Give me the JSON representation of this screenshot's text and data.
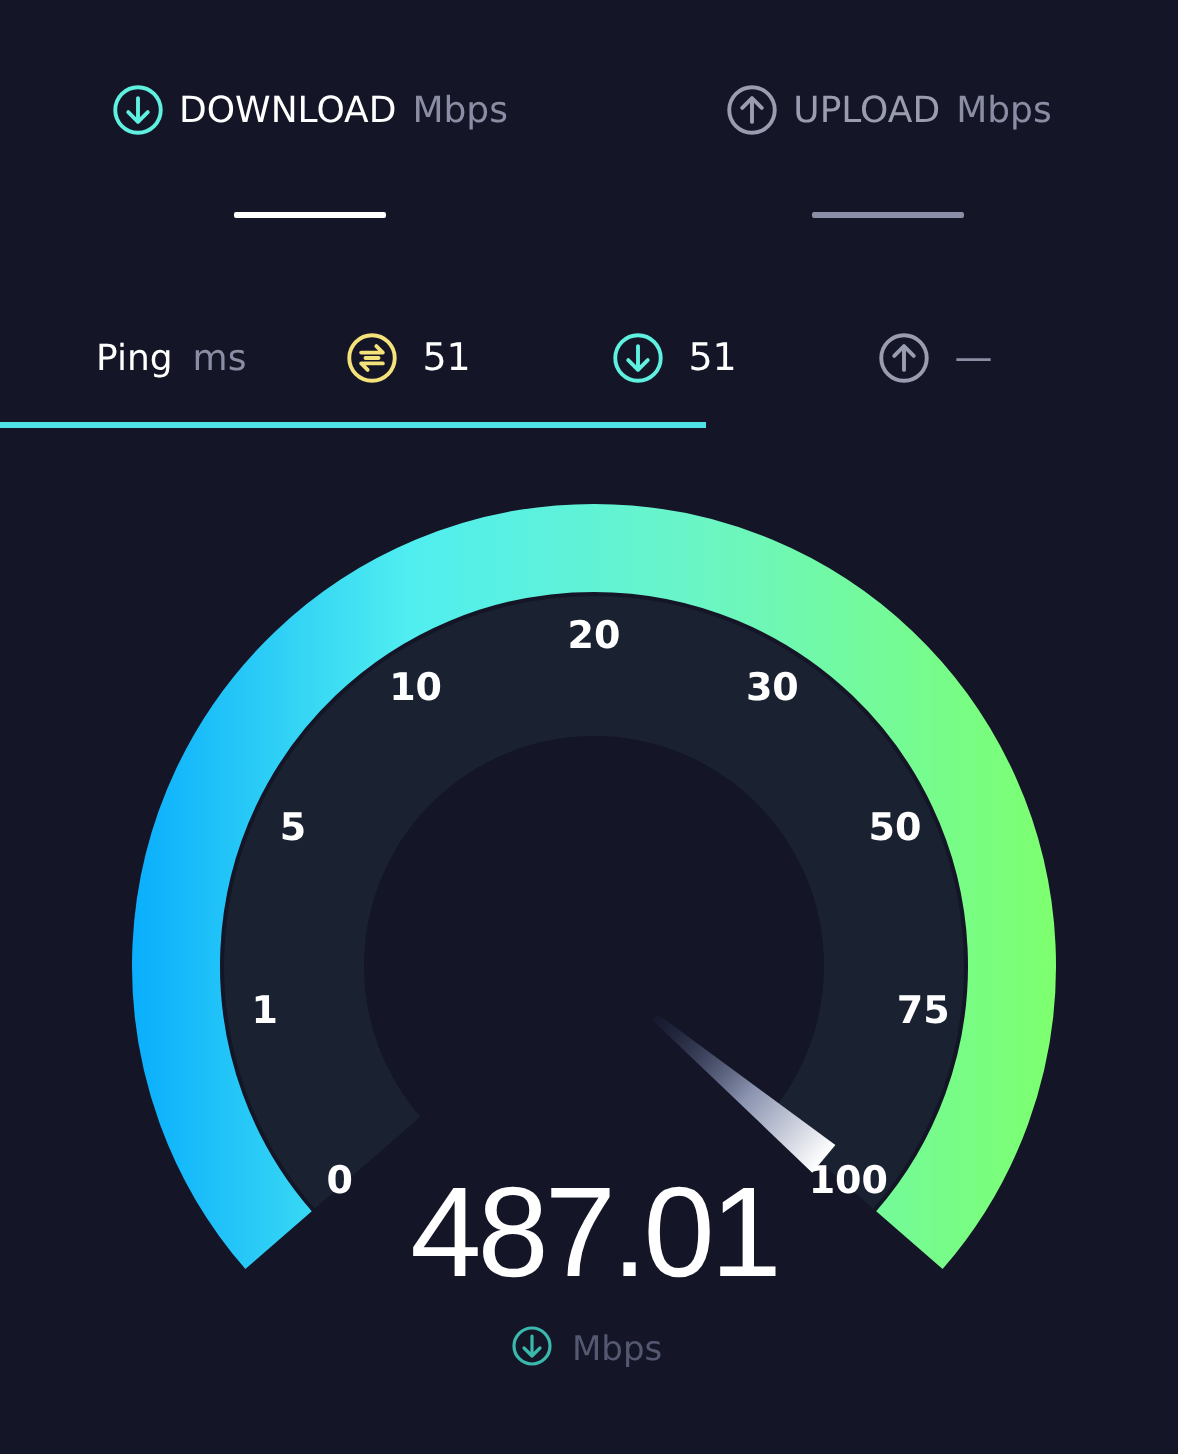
{
  "tabs": [
    {
      "kind": "download",
      "label": "DOWNLOAD",
      "unit": "Mbps",
      "selected": true
    },
    {
      "kind": "upload",
      "label": "UPLOAD",
      "unit": "Mbps",
      "selected": false
    }
  ],
  "ping": {
    "label": "Ping",
    "unit": "ms",
    "items": [
      {
        "kind": "jitter",
        "value": "51"
      },
      {
        "kind": "download",
        "value": "51"
      },
      {
        "kind": "upload",
        "value": "—"
      }
    ]
  },
  "gauge": {
    "ticks": [
      "0",
      "1",
      "5",
      "10",
      "20",
      "30",
      "50",
      "75",
      "100"
    ],
    "reading": "487.01",
    "unit": "Mbps"
  }
}
